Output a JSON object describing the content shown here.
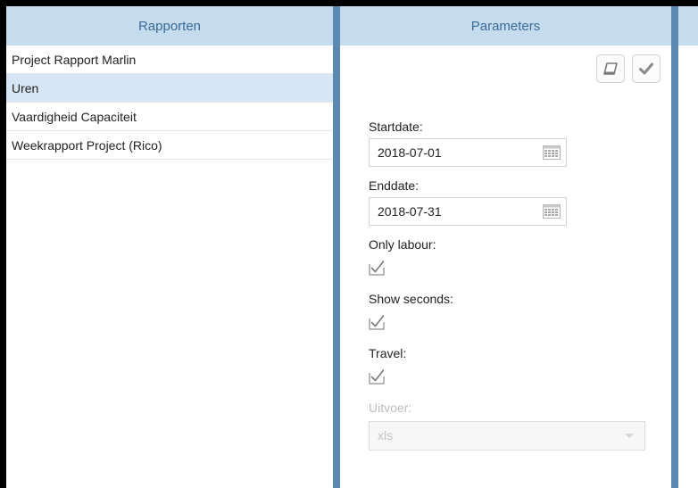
{
  "rapporten": {
    "header": "Rapporten",
    "items": [
      {
        "label": "Project Rapport Marlin",
        "selected": false
      },
      {
        "label": "Uren",
        "selected": true
      },
      {
        "label": "Vaardigheid Capaciteit",
        "selected": false
      },
      {
        "label": "Weekrapport Project (Rico)",
        "selected": false
      }
    ]
  },
  "parameters": {
    "header": "Parameters",
    "toolbar": {
      "clear_icon": "eraser-icon",
      "apply_icon": "checkmark-icon"
    },
    "startdate": {
      "label": "Startdate:",
      "value": "2018-07-01",
      "icon": "calendar-icon"
    },
    "enddate": {
      "label": "Enddate:",
      "value": "2018-07-31",
      "icon": "calendar-icon"
    },
    "only_labour": {
      "label": "Only labour:",
      "checked": true
    },
    "show_seconds": {
      "label": "Show seconds:",
      "checked": true
    },
    "travel": {
      "label": "Travel:",
      "checked": true
    },
    "uitvoer": {
      "label": "Uitvoer:",
      "value": "xls",
      "disabled": true
    }
  },
  "colors": {
    "header_bg": "#c5dbee",
    "header_text": "#3c6a96",
    "divider": "#5b89b2",
    "selected_row": "#d6e6f4"
  }
}
